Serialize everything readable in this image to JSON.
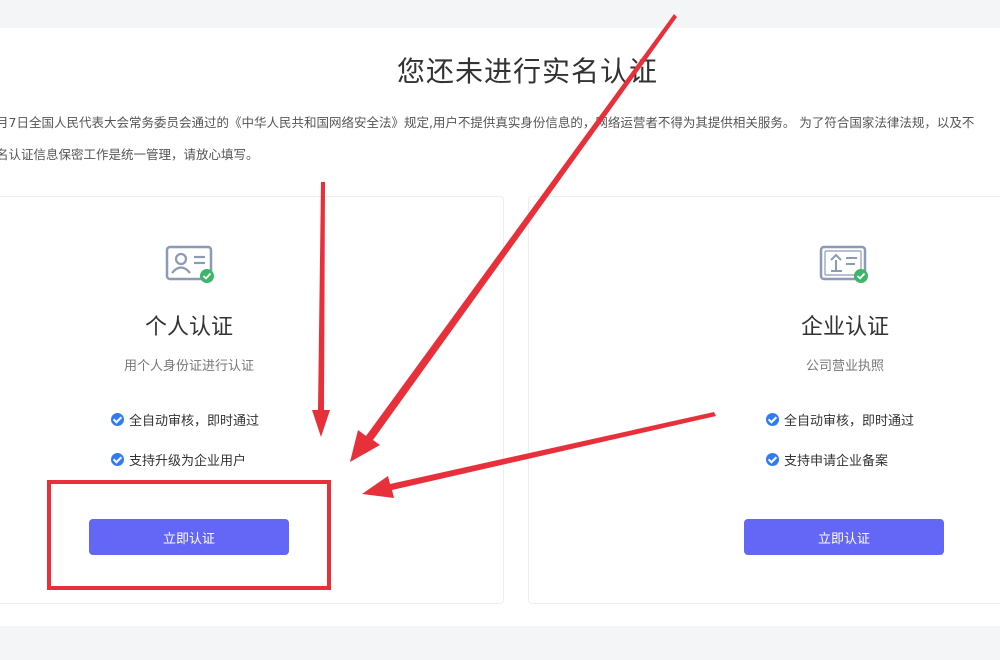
{
  "page": {
    "title": "您还未进行实名认证",
    "notice_line1": "月7日全国人民代表大会常务委员会通过的《中华人民共和国网络安全法》规定,用户不提供真实身份信息的，网络运营者不得为其提供相关服务。 为了符合国家法律法规，以及不",
    "notice_line2": "名认证信息保密工作是统一管理，请放心填写。"
  },
  "cards": [
    {
      "title": "个人认证",
      "subtitle": "用个人身份证进行认证",
      "features": [
        "全自动审核，即时通过",
        "支持升级为企业用户"
      ],
      "button_label": "立即认证",
      "icon": "personal-id-card-icon"
    },
    {
      "title": "企业认证",
      "subtitle": "公司营业执照",
      "features": [
        "全自动审核，即时通过",
        "支持申请企业备案"
      ],
      "button_label": "立即认证",
      "icon": "business-license-icon"
    }
  ],
  "colors": {
    "accent_button": "#6466f5",
    "check": "#2f7cf6",
    "annotation": "#e8303a",
    "icon_badge": "#3cb66a"
  }
}
